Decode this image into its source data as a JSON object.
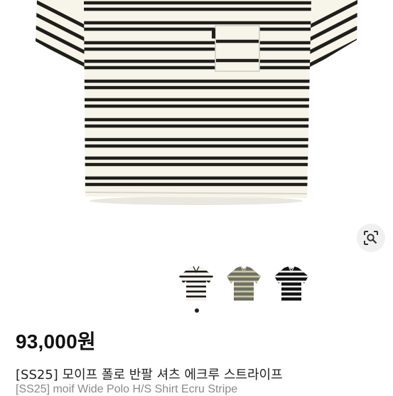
{
  "product": {
    "price": "93,000원",
    "title_ko": "[SS25] 모이프 폴로 반팔 셔츠 에크루 스트라이프",
    "title_en": "[SS25] moif Wide Polo H/S Shirt Ecru Stripe"
  },
  "gallery": {
    "thumbnail_variants": [
      {
        "name": "ecru-stripe",
        "base": "#f4f2ea",
        "stripe": "#1c1c1c"
      },
      {
        "name": "khaki-stripe",
        "base": "#6e7060",
        "stripe": "#c9c5a6"
      },
      {
        "name": "black-stripe",
        "base": "#141414",
        "stripe": "#efefef"
      }
    ],
    "active_index": 0,
    "icons": {
      "lens": "image-search-icon"
    }
  },
  "colors": {
    "shirt_base": "#f7f4ea",
    "stripe": "#1e1e1a",
    "dot_active": "#222222",
    "dot_inactive": "#d6d6d6"
  }
}
